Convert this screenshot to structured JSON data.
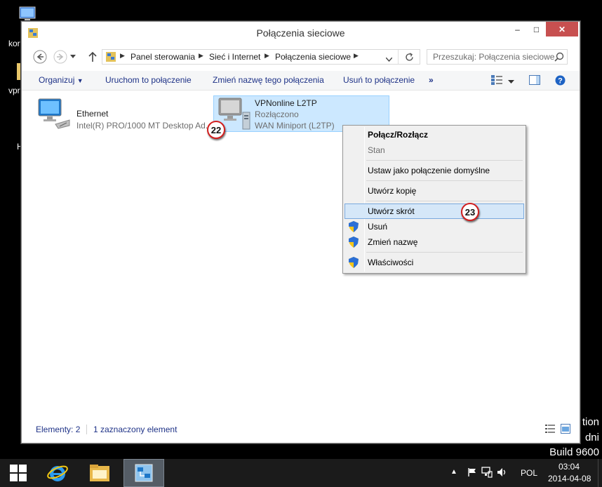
{
  "desktop": {
    "left_texts": [
      "kor",
      "vpr",
      "H"
    ],
    "watermark": [
      "tion",
      "dni",
      "Build 9600"
    ]
  },
  "window": {
    "title": "Połączenia sieciowe",
    "controls": {
      "minimize": "–",
      "maximize": "□",
      "close": "✕"
    }
  },
  "address": {
    "breadcrumbs": [
      "Panel sterowania",
      "Sieć i Internet",
      "Połączenia sieciowe"
    ],
    "search_placeholder": "Przeszukaj: Połączenia sieciowe"
  },
  "commands": {
    "organize": "Organizuj",
    "start": "Uruchom to połączenie",
    "rename": "Zmień nazwę tego połączenia",
    "delete": "Usuń to połączenie",
    "more": "»"
  },
  "connections": [
    {
      "name": "Ethernet",
      "line2": "Intel(R) PRO/1000 MT Desktop Ad...",
      "line3": ""
    },
    {
      "name": "VPNonline L2TP",
      "line2": "Rozłączono",
      "line3": "WAN Miniport (L2TP)"
    }
  ],
  "context_menu": {
    "items": [
      {
        "label": "Połącz/Rozłącz",
        "bold": true,
        "shield": false
      },
      {
        "label": "Stan",
        "disabled": true,
        "shield": false
      },
      {
        "label": "Ustaw jako połączenie domyślne",
        "shield": false
      },
      {
        "label": "Utwórz kopię",
        "shield": false
      },
      {
        "label": "Utwórz skrót",
        "highlighted": true,
        "shield": false
      },
      {
        "label": "Usuń",
        "shield": true
      },
      {
        "label": "Zmień nazwę",
        "shield": true
      },
      {
        "label": "Właściwości",
        "shield": true
      }
    ]
  },
  "badges": [
    "22",
    "23"
  ],
  "status": {
    "count": "Elementy: 2",
    "selected": "1 zaznaczony element"
  },
  "taskbar": {
    "language": "POL",
    "time": "03:04",
    "date": "2014-04-08"
  },
  "colors": {
    "selection": "#cce8ff",
    "close_button": "#c75050",
    "link_text": "#1e3287",
    "badge_ring": "#d21f1f"
  }
}
